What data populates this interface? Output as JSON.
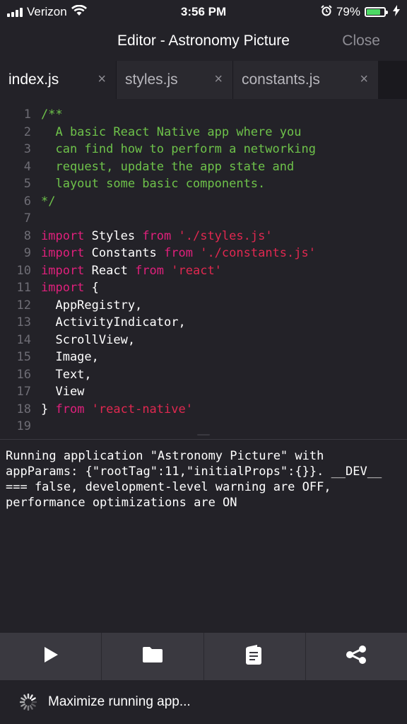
{
  "status_bar": {
    "carrier": "Verizon",
    "time": "3:56 PM",
    "battery_percent": "79%",
    "battery_level": 0.79,
    "icons": [
      "signal-icon",
      "wifi-icon",
      "alarm-icon",
      "battery-icon",
      "charging-icon"
    ]
  },
  "nav": {
    "title": "Editor - Astronomy Picture",
    "close_label": "Close"
  },
  "tabs": [
    {
      "label": "index.js",
      "active": true
    },
    {
      "label": "styles.js",
      "active": false
    },
    {
      "label": "constants.js",
      "active": false
    }
  ],
  "tab_close_symbol": "×",
  "editor": {
    "lines": [
      {
        "n": "1",
        "tokens": [
          {
            "t": "/**",
            "c": "comment"
          }
        ]
      },
      {
        "n": "2",
        "tokens": [
          {
            "t": "  A basic React Native app where you",
            "c": "comment"
          }
        ]
      },
      {
        "n": "3",
        "tokens": [
          {
            "t": "  can find how to perform a networking",
            "c": "comment"
          }
        ]
      },
      {
        "n": "4",
        "tokens": [
          {
            "t": "  request, update the app state and",
            "c": "comment"
          }
        ]
      },
      {
        "n": "5",
        "tokens": [
          {
            "t": "  layout some basic components.",
            "c": "comment"
          }
        ]
      },
      {
        "n": "6",
        "tokens": [
          {
            "t": "*/",
            "c": "comment"
          }
        ]
      },
      {
        "n": "7",
        "tokens": []
      },
      {
        "n": "8",
        "tokens": [
          {
            "t": "import",
            "c": "keyword"
          },
          {
            "t": " Styles ",
            "c": "plain"
          },
          {
            "t": "from",
            "c": "keyword"
          },
          {
            "t": " './styles.js'",
            "c": "string"
          }
        ]
      },
      {
        "n": "9",
        "tokens": [
          {
            "t": "import",
            "c": "keyword"
          },
          {
            "t": " Constants ",
            "c": "plain"
          },
          {
            "t": "from",
            "c": "keyword"
          },
          {
            "t": " './constants.js'",
            "c": "string"
          }
        ]
      },
      {
        "n": "10",
        "tokens": [
          {
            "t": "import",
            "c": "keyword"
          },
          {
            "t": " React ",
            "c": "plain"
          },
          {
            "t": "from",
            "c": "keyword"
          },
          {
            "t": " 'react'",
            "c": "string"
          }
        ]
      },
      {
        "n": "11",
        "tokens": [
          {
            "t": "import",
            "c": "keyword"
          },
          {
            "t": " {",
            "c": "plain"
          }
        ]
      },
      {
        "n": "12",
        "tokens": [
          {
            "t": "  AppRegistry,",
            "c": "plain"
          }
        ]
      },
      {
        "n": "13",
        "tokens": [
          {
            "t": "  ActivityIndicator,",
            "c": "plain"
          }
        ]
      },
      {
        "n": "14",
        "tokens": [
          {
            "t": "  ScrollView,",
            "c": "plain"
          }
        ]
      },
      {
        "n": "15",
        "tokens": [
          {
            "t": "  Image,",
            "c": "plain"
          }
        ]
      },
      {
        "n": "16",
        "tokens": [
          {
            "t": "  Text,",
            "c": "plain"
          }
        ]
      },
      {
        "n": "17",
        "tokens": [
          {
            "t": "  View",
            "c": "plain"
          }
        ]
      },
      {
        "n": "18",
        "tokens": [
          {
            "t": "} ",
            "c": "plain"
          },
          {
            "t": "from",
            "c": "keyword"
          },
          {
            "t": " 'react-native'",
            "c": "string"
          }
        ]
      },
      {
        "n": "19",
        "tokens": []
      }
    ]
  },
  "console": {
    "output": "Running application \"Astronomy Picture\" with appParams: {\"rootTag\":11,\"initialProps\":{}}. __DEV__ === false, development-level warning are OFF, performance optimizations are ON"
  },
  "toolbar": {
    "buttons": [
      {
        "icon": "play-icon"
      },
      {
        "icon": "folder-icon"
      },
      {
        "icon": "clipboard-icon"
      },
      {
        "icon": "share-icon"
      }
    ]
  },
  "footer": {
    "text": "Maximize running app..."
  },
  "colors": {
    "background": "#232228",
    "comment": "#6ec24a",
    "keyword": "#e0207c",
    "string": "#e02850",
    "toolbar": "#3a3940"
  }
}
